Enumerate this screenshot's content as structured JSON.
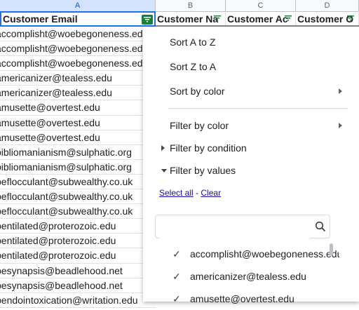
{
  "columns": [
    "A",
    "B",
    "C",
    "D"
  ],
  "header": {
    "a": "Customer Email",
    "b": "Customer Na",
    "c": "Customer Ac",
    "d": "Customer O"
  },
  "rows": [
    "accomplisht@woebegoneness.edu",
    "accomplisht@woebegoneness.edu",
    "accomplisht@woebegoneness.edu",
    "americanizer@tealess.edu",
    "americanizer@tealess.edu",
    "amusette@overtest.edu",
    "amusette@overtest.edu",
    "amusette@overtest.edu",
    "bibliomanianism@sulphatic.org",
    "bibliomanianism@sulphatic.org",
    "beflocculant@subwealthy.co.uk",
    "beflocculant@subwealthy.co.uk",
    "beflocculant@subwealthy.co.uk",
    "bentilated@proterozoic.edu",
    "bentilated@proterozoic.edu",
    "bentilated@proterozoic.edu",
    "besynapsis@beadlehood.net",
    "besynapsis@beadlehood.net",
    "bendointoxication@writation.edu"
  ],
  "menu": {
    "sort_az": "Sort A to Z",
    "sort_za": "Sort Z to A",
    "sort_color": "Sort by color",
    "filter_color": "Filter by color",
    "filter_condition": "Filter by condition",
    "filter_values": "Filter by values",
    "select_all": "Select all",
    "separator": "-",
    "clear": "Clear",
    "search_value": "",
    "values": [
      {
        "label": "accomplisht@woebegoneness.edu",
        "checked": "✓"
      },
      {
        "label": "americanizer@tealess.edu",
        "checked": "✓"
      },
      {
        "label": "amusette@overtest.edu",
        "checked": "✓"
      }
    ]
  },
  "icons": {
    "filter": "filter-icon",
    "search": "search-icon",
    "check": "check-icon"
  },
  "colors": {
    "active_filter": "#188038",
    "selection_blue": "#1a73e8",
    "link": "#1a0dab"
  }
}
